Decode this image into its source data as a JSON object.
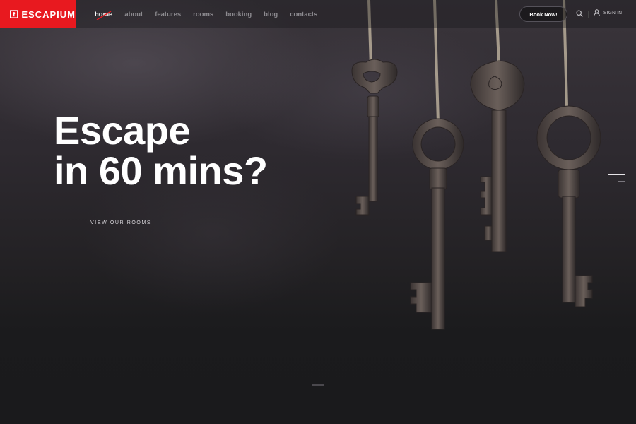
{
  "brand": {
    "name": "ESCAPIUM",
    "accent_color": "#e8191f",
    "logo_icon": "keyhole-icon"
  },
  "nav": {
    "items": [
      {
        "label": "home",
        "active": true
      },
      {
        "label": "about",
        "active": false
      },
      {
        "label": "features",
        "active": false
      },
      {
        "label": "rooms",
        "active": false
      },
      {
        "label": "booking",
        "active": false
      },
      {
        "label": "blog",
        "active": false
      },
      {
        "label": "contacts",
        "active": false
      }
    ]
  },
  "header": {
    "book_label": "Book Now!",
    "search_icon": "search-icon",
    "signin_label": "SIGN IN",
    "user_icon": "user-icon"
  },
  "hero": {
    "headline_line1": "Escape",
    "headline_line2": "in 60 mins?",
    "cta_label": "VIEW OUR ROOMS"
  },
  "slider": {
    "slide_count": 4,
    "active_index": 2
  }
}
